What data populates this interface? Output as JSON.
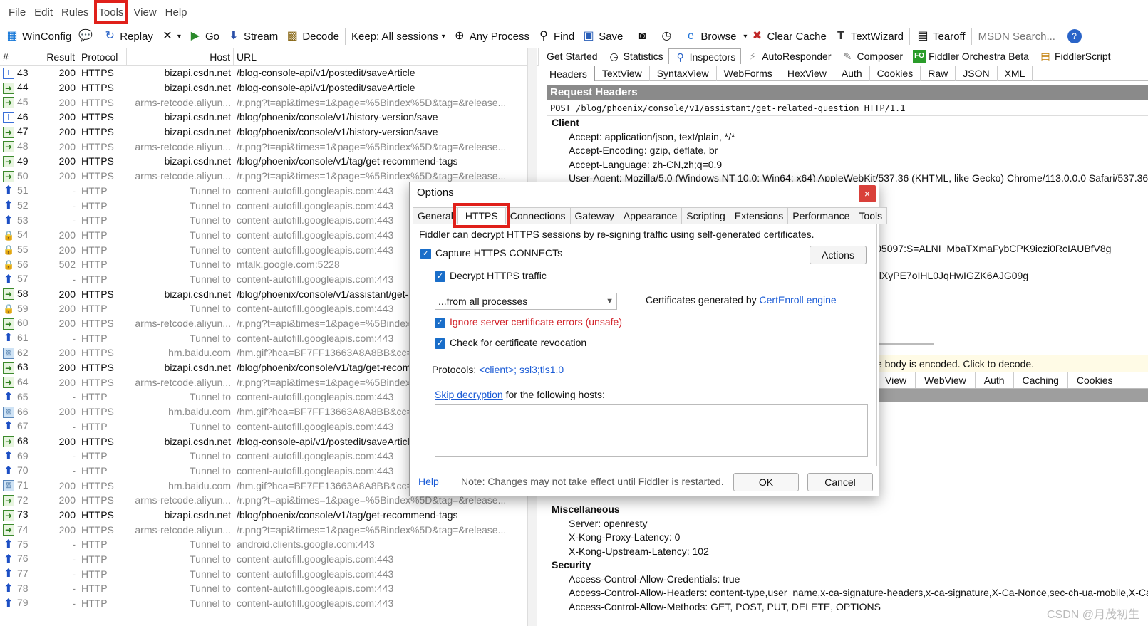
{
  "menu": [
    "File",
    "Edit",
    "Rules",
    "Tools",
    "View",
    "Help"
  ],
  "toolbar": {
    "winconfig": "WinConfig",
    "replay": "Replay",
    "go": "Go",
    "stream": "Stream",
    "decode": "Decode",
    "keep": "Keep: All sessions",
    "any_process": "Any Process",
    "find": "Find",
    "save": "Save",
    "browse": "Browse",
    "clear_cache": "Clear Cache",
    "textwizard": "TextWizard",
    "tearoff": "Tearoff",
    "search_placeholder": "MSDN Search..."
  },
  "sessions": {
    "headers": [
      "#",
      "Result",
      "Protocol",
      "Host",
      "URL"
    ],
    "rows": [
      {
        "icon": "info",
        "num": "43",
        "result": "200",
        "protocol": "HTTPS",
        "host": "bizapi.csdn.net",
        "url": "/blog-console-api/v1/postedit/saveArticle",
        "dim": false
      },
      {
        "icon": "arrow",
        "num": "44",
        "result": "200",
        "protocol": "HTTPS",
        "host": "bizapi.csdn.net",
        "url": "/blog-console-api/v1/postedit/saveArticle",
        "dim": false
      },
      {
        "icon": "arrow",
        "num": "45",
        "result": "200",
        "protocol": "HTTPS",
        "host": "arms-retcode.aliyun...",
        "url": "/r.png?t=api&times=1&page=%5Bindex%5D&tag=&release...",
        "dim": true
      },
      {
        "icon": "info",
        "num": "46",
        "result": "200",
        "protocol": "HTTPS",
        "host": "bizapi.csdn.net",
        "url": "/blog/phoenix/console/v1/history-version/save",
        "dim": false
      },
      {
        "icon": "arrow",
        "num": "47",
        "result": "200",
        "protocol": "HTTPS",
        "host": "bizapi.csdn.net",
        "url": "/blog/phoenix/console/v1/history-version/save",
        "dim": false
      },
      {
        "icon": "arrow",
        "num": "48",
        "result": "200",
        "protocol": "HTTPS",
        "host": "arms-retcode.aliyun...",
        "url": "/r.png?t=api&times=1&page=%5Bindex%5D&tag=&release...",
        "dim": true
      },
      {
        "icon": "arrow",
        "num": "49",
        "result": "200",
        "protocol": "HTTPS",
        "host": "bizapi.csdn.net",
        "url": "/blog/phoenix/console/v1/tag/get-recommend-tags",
        "dim": false
      },
      {
        "icon": "arrow",
        "num": "50",
        "result": "200",
        "protocol": "HTTPS",
        "host": "arms-retcode.aliyun...",
        "url": "/r.png?t=api&times=1&page=%5Bindex%5D&tag=&release...",
        "dim": true
      },
      {
        "icon": "up",
        "num": "51",
        "result": "-",
        "protocol": "HTTP",
        "host": "Tunnel to",
        "url": "content-autofill.googleapis.com:443",
        "dim": true
      },
      {
        "icon": "up",
        "num": "52",
        "result": "-",
        "protocol": "HTTP",
        "host": "Tunnel to",
        "url": "content-autofill.googleapis.com:443",
        "dim": true
      },
      {
        "icon": "up",
        "num": "53",
        "result": "-",
        "protocol": "HTTP",
        "host": "Tunnel to",
        "url": "content-autofill.googleapis.com:443",
        "dim": true
      },
      {
        "icon": "lock",
        "num": "54",
        "result": "200",
        "protocol": "HTTP",
        "host": "Tunnel to",
        "url": "content-autofill.googleapis.com:443",
        "dim": true
      },
      {
        "icon": "lock",
        "num": "55",
        "result": "200",
        "protocol": "HTTP",
        "host": "Tunnel to",
        "url": "content-autofill.googleapis.com:443",
        "dim": true
      },
      {
        "icon": "lock",
        "num": "56",
        "result": "502",
        "protocol": "HTTP",
        "host": "Tunnel to",
        "url": "mtalk.google.com:5228",
        "dim": true
      },
      {
        "icon": "up",
        "num": "57",
        "result": "-",
        "protocol": "HTTP",
        "host": "Tunnel to",
        "url": "content-autofill.googleapis.com:443",
        "dim": true
      },
      {
        "icon": "arrow",
        "num": "58",
        "result": "200",
        "protocol": "HTTPS",
        "host": "bizapi.csdn.net",
        "url": "/blog/phoenix/console/v1/assistant/get-",
        "dim": false
      },
      {
        "icon": "lock",
        "num": "59",
        "result": "200",
        "protocol": "HTTP",
        "host": "Tunnel to",
        "url": "content-autofill.googleapis.com:443",
        "dim": true
      },
      {
        "icon": "arrow",
        "num": "60",
        "result": "200",
        "protocol": "HTTPS",
        "host": "arms-retcode.aliyun...",
        "url": "/r.png?t=api&times=1&page=%5Bindex",
        "dim": true
      },
      {
        "icon": "up",
        "num": "61",
        "result": "-",
        "protocol": "HTTP",
        "host": "Tunnel to",
        "url": "content-autofill.googleapis.com:443",
        "dim": true
      },
      {
        "icon": "img",
        "num": "62",
        "result": "200",
        "protocol": "HTTPS",
        "host": "hm.baidu.com",
        "url": "/hm.gif?hca=BF7FF13663A8A8BB&cc=1",
        "dim": true
      },
      {
        "icon": "arrow",
        "num": "63",
        "result": "200",
        "protocol": "HTTPS",
        "host": "bizapi.csdn.net",
        "url": "/blog/phoenix/console/v1/tag/get-recom",
        "dim": false
      },
      {
        "icon": "arrow",
        "num": "64",
        "result": "200",
        "protocol": "HTTPS",
        "host": "arms-retcode.aliyun...",
        "url": "/r.png?t=api&times=1&page=%5Bindex",
        "dim": true
      },
      {
        "icon": "up",
        "num": "65",
        "result": "-",
        "protocol": "HTTP",
        "host": "Tunnel to",
        "url": "content-autofill.googleapis.com:443",
        "dim": true
      },
      {
        "icon": "img",
        "num": "66",
        "result": "200",
        "protocol": "HTTPS",
        "host": "hm.baidu.com",
        "url": "/hm.gif?hca=BF7FF13663A8A8BB&cc=1",
        "dim": true
      },
      {
        "icon": "up",
        "num": "67",
        "result": "-",
        "protocol": "HTTP",
        "host": "Tunnel to",
        "url": "content-autofill.googleapis.com:443",
        "dim": true
      },
      {
        "icon": "arrow",
        "num": "68",
        "result": "200",
        "protocol": "HTTPS",
        "host": "bizapi.csdn.net",
        "url": "/blog-console-api/v1/postedit/saveArticl",
        "dim": false
      },
      {
        "icon": "up",
        "num": "69",
        "result": "-",
        "protocol": "HTTP",
        "host": "Tunnel to",
        "url": "content-autofill.googleapis.com:443",
        "dim": true
      },
      {
        "icon": "up",
        "num": "70",
        "result": "-",
        "protocol": "HTTP",
        "host": "Tunnel to",
        "url": "content-autofill.googleapis.com:443",
        "dim": true
      },
      {
        "icon": "img",
        "num": "71",
        "result": "200",
        "protocol": "HTTPS",
        "host": "hm.baidu.com",
        "url": "/hm.gif?hca=BF7FF13663A8A8BB&cc=1",
        "dim": true
      },
      {
        "icon": "arrow",
        "num": "72",
        "result": "200",
        "protocol": "HTTPS",
        "host": "arms-retcode.aliyun...",
        "url": "/r.png?t=api&times=1&page=%5Bindex%5D&tag=&release...",
        "dim": true
      },
      {
        "icon": "arrow",
        "num": "73",
        "result": "200",
        "protocol": "HTTPS",
        "host": "bizapi.csdn.net",
        "url": "/blog/phoenix/console/v1/tag/get-recommend-tags",
        "dim": false
      },
      {
        "icon": "arrow",
        "num": "74",
        "result": "200",
        "protocol": "HTTPS",
        "host": "arms-retcode.aliyun...",
        "url": "/r.png?t=api&times=1&page=%5Bindex%5D&tag=&release...",
        "dim": true
      },
      {
        "icon": "up",
        "num": "75",
        "result": "-",
        "protocol": "HTTP",
        "host": "Tunnel to",
        "url": "android.clients.google.com:443",
        "dim": true
      },
      {
        "icon": "up",
        "num": "76",
        "result": "-",
        "protocol": "HTTP",
        "host": "Tunnel to",
        "url": "content-autofill.googleapis.com:443",
        "dim": true
      },
      {
        "icon": "up",
        "num": "77",
        "result": "-",
        "protocol": "HTTP",
        "host": "Tunnel to",
        "url": "content-autofill.googleapis.com:443",
        "dim": true
      },
      {
        "icon": "up",
        "num": "78",
        "result": "-",
        "protocol": "HTTP",
        "host": "Tunnel to",
        "url": "content-autofill.googleapis.com:443",
        "dim": true
      },
      {
        "icon": "up",
        "num": "79",
        "result": "-",
        "protocol": "HTTP",
        "host": "Tunnel to",
        "url": "content-autofill.googleapis.com:443",
        "dim": true
      }
    ]
  },
  "inspector": {
    "top_tabs": [
      "Get Started",
      "Statistics",
      "Inspectors",
      "AutoResponder",
      "Composer",
      "Fiddler Orchestra Beta",
      "FiddlerScript"
    ],
    "fo_badge": "FO",
    "req_tabs": [
      "Headers",
      "TextView",
      "SyntaxView",
      "WebForms",
      "HexView",
      "Auth",
      "Cookies",
      "Raw",
      "JSON",
      "XML"
    ],
    "req_title": "Request Headers",
    "req_line": "POST /blog/phoenix/console/v1/assistant/get-related-question HTTP/1.1",
    "client_group": "Client",
    "client_items": [
      "Accept: application/json, text/plain, */*",
      "Accept-Encoding: gzip, deflate, br",
      "Accept-Language: zh-CN,zh;q=0.9",
      "User-Agent: Mozilla/5.0 (Windows NT 10.0; Win64; x64) AppleWebKit/537.36 (KHTML, like Gecko) Chrome/113.0.0.0 Safari/537.36"
    ],
    "cookie_frag1": "586105097:S=ALNI_MbaTXmaFybCPK9iczi0RcIAUBfV8g",
    "cookie_frag2": "_MZ_lXyPE7oIHL0JqHwIGZK6AJG09g",
    "resp_notice": "e body is encoded. Click to decode.",
    "resp_tabs": [
      "View",
      "WebView",
      "Auth",
      "Caching",
      "Cookies"
    ],
    "misc_group": "Miscellaneous",
    "misc_items": [
      "Server: openresty",
      "X-Kong-Proxy-Latency: 0",
      "X-Kong-Upstream-Latency: 102"
    ],
    "security_group": "Security",
    "security_items": [
      "Access-Control-Allow-Credentials: true",
      "Access-Control-Allow-Headers: content-type,user_name,x-ca-signature-headers,x-ca-signature,X-Ca-Nonce,sec-ch-ua-mobile,X-Ca",
      "Access-Control-Allow-Methods: GET, POST, PUT, DELETE, OPTIONS"
    ]
  },
  "dialog": {
    "title": "Options",
    "close": "×",
    "tabs": [
      "General",
      "HTTPS",
      "Connections",
      "Gateway",
      "Appearance",
      "Scripting",
      "Extensions",
      "Performance",
      "Tools"
    ],
    "intro": "Fiddler can decrypt HTTPS sessions by re-signing traffic using self-generated certificates.",
    "capture": "Capture HTTPS CONNECTs",
    "actions": "Actions",
    "decrypt": "Decrypt HTTPS traffic",
    "select_value": "...from all processes",
    "cert_prefix": "Certificates generated by ",
    "cert_link": "CertEnroll engine",
    "ignore": "Ignore server certificate errors (unsafe)",
    "revocation": "Check for certificate revocation",
    "protocols_label": "Protocols: ",
    "protocols_value": "<client>; ssl3;tls1.0",
    "skip_link": "Skip decryption",
    "skip_rest": " for the following hosts:",
    "help": "Help",
    "note": "Note: Changes may not take effect until Fiddler is restarted.",
    "ok": "OK",
    "cancel": "Cancel"
  },
  "watermark": "CSDN @月茂初生"
}
